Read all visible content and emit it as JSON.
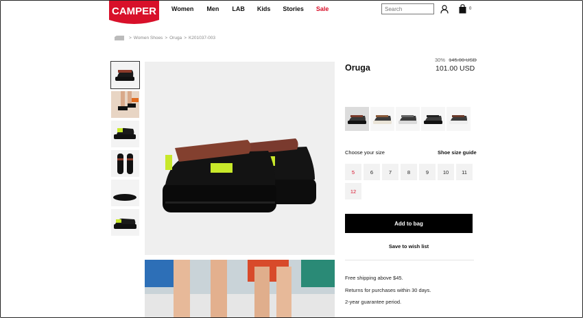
{
  "brand": {
    "logo_text": "CAMPER",
    "accent": "#d8102a"
  },
  "nav": {
    "items": [
      {
        "label": "Women",
        "sale": false
      },
      {
        "label": "Men",
        "sale": false
      },
      {
        "label": "LAB",
        "sale": false
      },
      {
        "label": "Kids",
        "sale": false
      },
      {
        "label": "Stories",
        "sale": false
      },
      {
        "label": "Sale",
        "sale": true
      }
    ]
  },
  "search": {
    "placeholder": "Search"
  },
  "cart": {
    "count": "0"
  },
  "breadcrumb": {
    "items": [
      "Women Shoes",
      "Oruga",
      "K201037-003"
    ],
    "separator": ">"
  },
  "product": {
    "name": "Oruga",
    "discount": "30%",
    "old_price": "145.00 USD",
    "price": "101.00 USD"
  },
  "colors": {
    "selected_index": 0,
    "swatches": [
      {
        "name": "black-brown",
        "sole": "#111111",
        "strap": "#7a3a2a"
      },
      {
        "name": "beige",
        "sole": "#e9e3d6",
        "strap": "#8a5a3a"
      },
      {
        "name": "grey",
        "sole": "#d9d9d9",
        "strap": "#666666"
      },
      {
        "name": "black",
        "sole": "#111111",
        "strap": "#222222"
      },
      {
        "name": "cream",
        "sole": "#eeeeee",
        "strap": "#6b3a2a"
      }
    ]
  },
  "sizes": {
    "label": "Choose your size",
    "guide_label": "Shoe size guide",
    "items": [
      {
        "label": "5",
        "available": false
      },
      {
        "label": "6",
        "available": true
      },
      {
        "label": "7",
        "available": true
      },
      {
        "label": "8",
        "available": true
      },
      {
        "label": "9",
        "available": true
      },
      {
        "label": "10",
        "available": true
      },
      {
        "label": "11",
        "available": true
      },
      {
        "label": "12",
        "available": false
      }
    ]
  },
  "actions": {
    "add_to_bag": "Add to bag",
    "wishlist": "Save to wish list"
  },
  "info": [
    "Free shipping above $45.",
    "Returns for purchases within 30 days.",
    "2-year guarantee period."
  ]
}
